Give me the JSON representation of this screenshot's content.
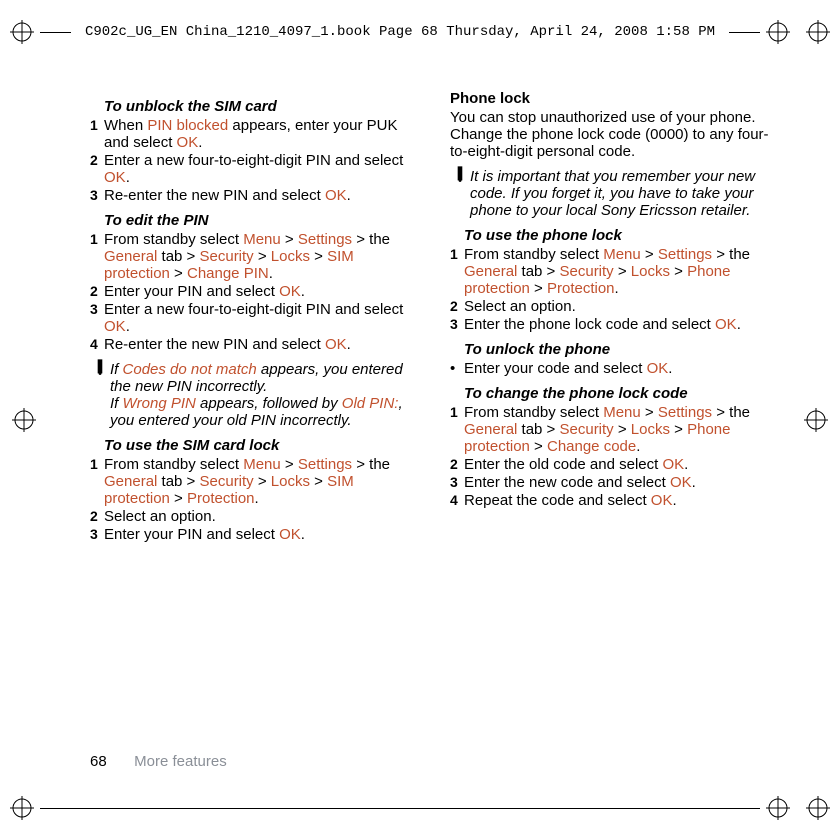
{
  "meta": {
    "book_label": "C902c_UG_EN China_1210_4097_1.book  Page 68  Thursday, April 24, 2008  1:58 PM"
  },
  "left": {
    "unblock": {
      "title": "To unblock the SIM card",
      "steps": {
        "s1a": "When ",
        "s1b": "PIN blocked",
        "s1c": " appears, enter your PUK and select ",
        "s1d": "OK",
        "s1e": ".",
        "s2a": "Enter a new four-to-eight-digit PIN and select ",
        "s2b": "OK",
        "s2c": ".",
        "s3a": "Re-enter the new PIN and select ",
        "s3b": "OK",
        "s3c": "."
      }
    },
    "edit": {
      "title": "To edit the PIN",
      "steps": {
        "s1a": "From standby select ",
        "s1b": "Menu",
        "s1c": " > ",
        "s1d": "Settings",
        "s1e": " > the ",
        "s1f": "General",
        "s1g": " tab > ",
        "s1h": "Security",
        "s1i": " > ",
        "s1j": "Locks",
        "s1k": " > ",
        "s1l": "SIM protection",
        "s1m": " > ",
        "s1n": "Change PIN",
        "s1o": ".",
        "s2a": "Enter your PIN and select ",
        "s2b": "OK",
        "s2c": ".",
        "s3a": "Enter a new four-to-eight-digit PIN and select ",
        "s3b": "OK",
        "s3c": ".",
        "s4a": "Re-enter the new PIN and select ",
        "s4b": "OK",
        "s4c": "."
      }
    },
    "note1": {
      "l1a": "If ",
      "l1b": "Codes do not match",
      "l1c": " appears, you entered the new PIN incorrectly.",
      "l2a": "If ",
      "l2b": "Wrong PIN",
      "l2c": " appears, followed by ",
      "l2d": "Old PIN:",
      "l2e": ", you entered your old PIN incorrectly."
    },
    "simlock": {
      "title": "To use the SIM card lock",
      "steps": {
        "s1a": "From standby select ",
        "s1b": "Menu",
        "s1c": " > ",
        "s1d": "Settings",
        "s1e": " > the ",
        "s1f": "General",
        "s1g": " tab > ",
        "s1h": "Security",
        "s1i": " > ",
        "s1j": "Locks",
        "s1k": " > ",
        "s1l": "SIM protection",
        "s1m": " > ",
        "s1n": "Protection",
        "s1o": ".",
        "s2": "Select an option.",
        "s3a": "Enter your PIN and select ",
        "s3b": "OK",
        "s3c": "."
      }
    }
  },
  "right": {
    "phonelock_head": "Phone lock",
    "phonelock_intro": "You can stop unauthorized use of your phone. Change the phone lock code (0000) to any four-to-eight-digit personal code.",
    "note2": "It is important that you remember your new code. If you forget it, you have to take your phone to your local Sony Ericsson retailer.",
    "use": {
      "title": "To use the phone lock",
      "steps": {
        "s1a": "From standby select ",
        "s1b": "Menu",
        "s1c": " > ",
        "s1d": "Settings",
        "s1e": " > the ",
        "s1f": "General",
        "s1g": " tab > ",
        "s1h": "Security",
        "s1i": " > ",
        "s1j": "Locks",
        "s1k": " > ",
        "s1l": "Phone protection",
        "s1m": " > ",
        "s1n": "Protection",
        "s1o": ".",
        "s2": "Select an option.",
        "s3a": "Enter the phone lock code and select ",
        "s3b": "OK",
        "s3c": "."
      }
    },
    "unlock": {
      "title": "To unlock the phone",
      "b1a": "Enter your code and select ",
      "b1b": "OK",
      "b1c": "."
    },
    "change": {
      "title": "To change the phone lock code",
      "steps": {
        "s1a": "From standby select ",
        "s1b": "Menu",
        "s1c": " > ",
        "s1d": "Settings",
        "s1e": " > the ",
        "s1f": "General",
        "s1g": " tab > ",
        "s1h": "Security",
        "s1i": " > ",
        "s1j": "Locks",
        "s1k": " > ",
        "s1l": "Phone protection",
        "s1m": " > ",
        "s1n": "Change code",
        "s1o": ".",
        "s2a": "Enter the old code and select ",
        "s2b": "OK",
        "s2c": ".",
        "s3a": "Enter the new code and select ",
        "s3b": "OK",
        "s3c": ".",
        "s4a": "Repeat the code and select ",
        "s4b": "OK",
        "s4c": "."
      }
    }
  },
  "footer": {
    "page": "68",
    "section": "More features"
  },
  "nums": {
    "n1": "1",
    "n2": "2",
    "n3": "3",
    "n4": "4"
  }
}
